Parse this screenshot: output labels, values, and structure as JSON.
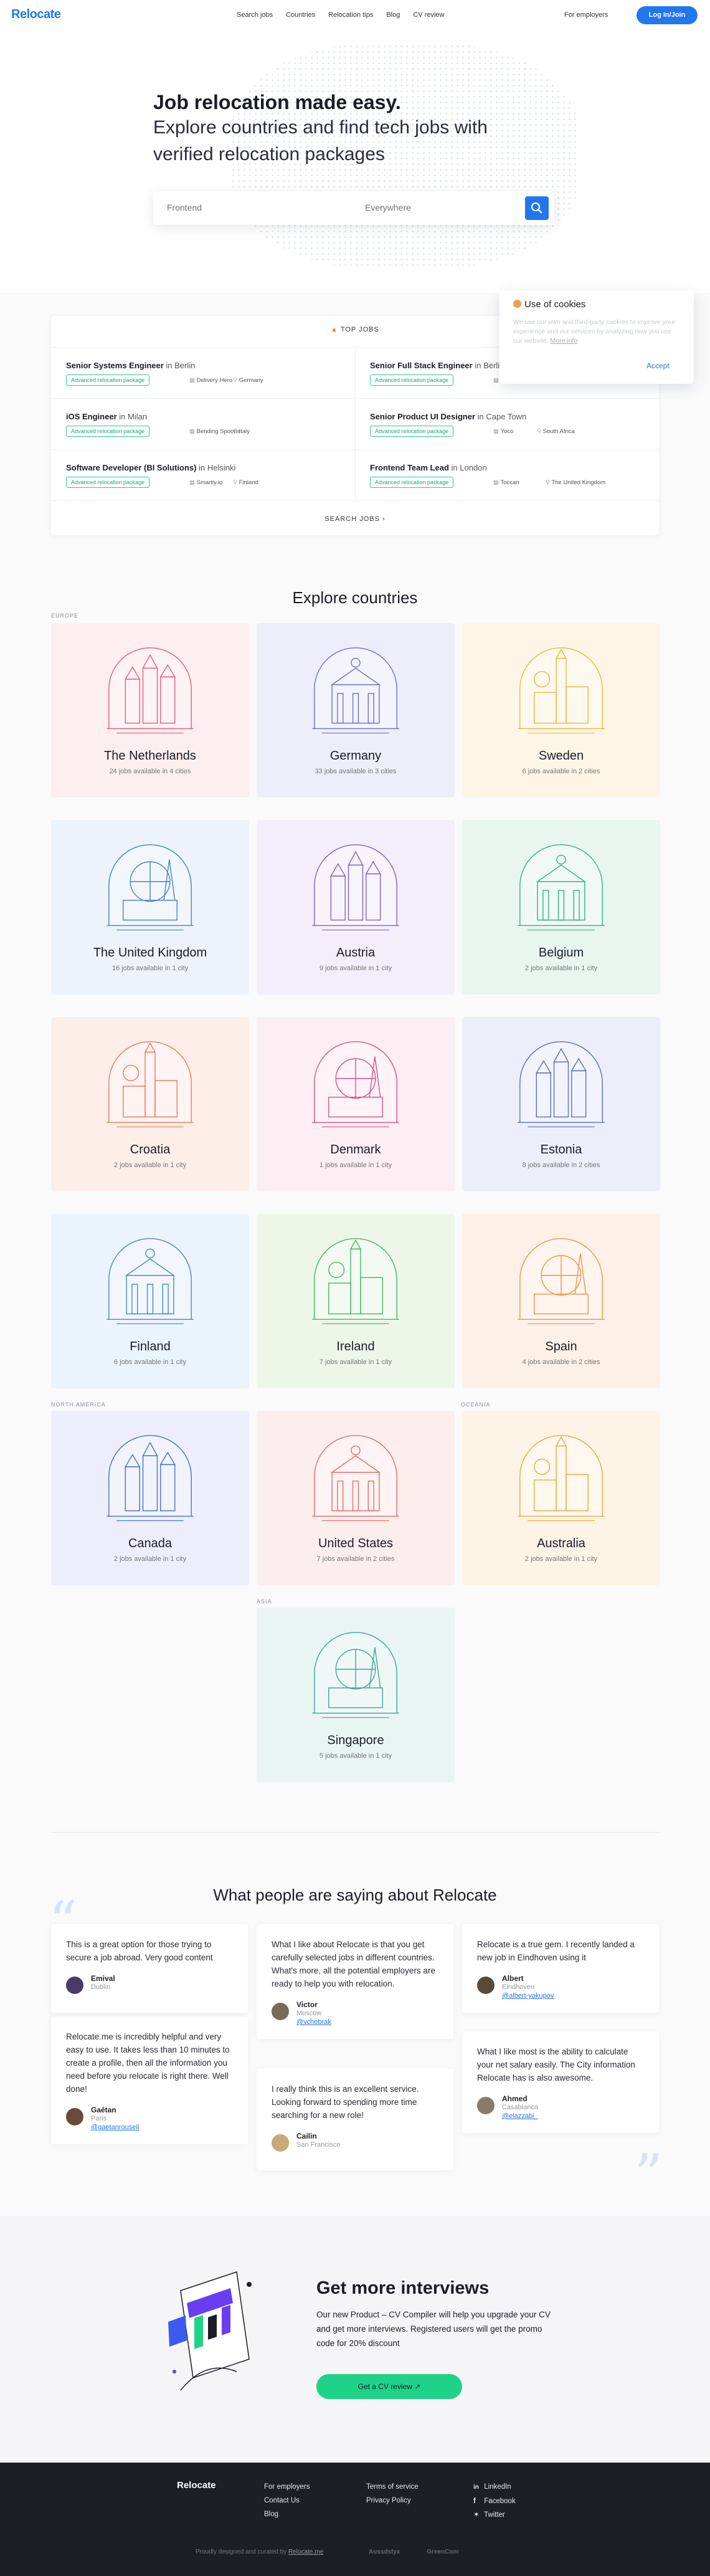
{
  "header": {
    "logo": "Relocate",
    "nav": [
      "Search jobs",
      "Countries",
      "Relocation tips",
      "Blog",
      "CV review"
    ],
    "employers": "For employers",
    "login": "Log In/Join"
  },
  "hero": {
    "title": "Job relocation made easy.",
    "subtitle_line1": "Explore countries and find tech jobs with",
    "subtitle_line2": "verified relocation packages",
    "search_placeholder": "Frontend",
    "location_placeholder": "Everywhere"
  },
  "cookie": {
    "title": "Use of cookies",
    "text": "We use our own and third-party cookies to improve your experience and our services by analyzing how you use our website.",
    "more": "More info",
    "accept": "Accept",
    "icon": "cookie-icon"
  },
  "jobs": {
    "heading": "TOP JOBS",
    "in": "in",
    "badge": "Advanced relocation package",
    "search_all": "SEARCH JOBS",
    "items": [
      {
        "title": "Senior Systems Engineer",
        "city": "Berlin",
        "company": "Delivery Hero",
        "country": "Germany"
      },
      {
        "title": "Senior Full Stack Engineer",
        "city": "Berlin",
        "company": "Babbel",
        "country": "Germany"
      },
      {
        "title": "iOS Engineer",
        "city": "Milan",
        "company": "Bending Spoons",
        "country": "Italy"
      },
      {
        "title": "Senior Product UI Designer",
        "city": "Cape Town",
        "company": "Yoco",
        "country": "South Africa"
      },
      {
        "title": "Software Developer (BI Solutions)",
        "city": "Helsinki",
        "company": "Smartly.io",
        "country": "Finland"
      },
      {
        "title": "Frontend Team Lead",
        "city": "London",
        "company": "Toccan",
        "country": "The United Kingdom"
      }
    ]
  },
  "explore": {
    "title": "Explore countries",
    "regions": {
      "europe": "EUROPE",
      "north_america": "NORTH AMERICA",
      "oceania": "OCEANIA",
      "asia": "ASIA"
    },
    "countries": [
      {
        "name": "The Netherlands",
        "jobs": "24 jobs available in 4 cities",
        "bg": "#fdeef0",
        "line": "#ea5c7a"
      },
      {
        "name": "Germany",
        "jobs": "33 jobs available in 3 cities",
        "bg": "#eeeefb",
        "line": "#6c6fd8"
      },
      {
        "name": "Sweden",
        "jobs": "6 jobs available in 2 cities",
        "bg": "#fdf6e6",
        "line": "#efb63f"
      },
      {
        "name": "The United Kingdom",
        "jobs": "16 jobs available in 1 city",
        "bg": "#ecf3fb",
        "line": "#4a7fcc"
      },
      {
        "name": "Austria",
        "jobs": "9 jobs available in 1 city",
        "bg": "#f3effa",
        "line": "#8262c4"
      },
      {
        "name": "Belgium",
        "jobs": "2 jobs available in 1 city",
        "bg": "#e9f6f0",
        "line": "#2fb58a"
      },
      {
        "name": "Croatia",
        "jobs": "2 jobs available in 1 city",
        "bg": "#fdeeea",
        "line": "#ea7a62"
      },
      {
        "name": "Denmark",
        "jobs": "1 jobs available in 1 city",
        "bg": "#fdeef3",
        "line": "#d9508a"
      },
      {
        "name": "Estonia",
        "jobs": "8 jobs available in 2 cities",
        "bg": "#eceffa",
        "line": "#5c6cc8"
      },
      {
        "name": "Finland",
        "jobs": "6 jobs available in 1 city",
        "bg": "#ebf3fc",
        "line": "#4a86d6"
      },
      {
        "name": "Ireland",
        "jobs": "7 jobs available in 1 city",
        "bg": "#ecf7ea",
        "line": "#4cb56a"
      },
      {
        "name": "Spain",
        "jobs": "4 jobs available in 2 cities",
        "bg": "#fdf0e6",
        "line": "#f0944a"
      },
      {
        "name": "Canada",
        "jobs": "2 jobs available in 1 city",
        "bg": "#eceffb",
        "line": "#4a6ed2"
      },
      {
        "name": "United States",
        "jobs": "7 jobs available in 2 cities",
        "bg": "#fdeeee",
        "line": "#e86a6a"
      },
      {
        "name": "Australia",
        "jobs": "2 jobs available in 1 city",
        "bg": "#fdf4e6",
        "line": "#eea83f"
      },
      {
        "name": "Singapore",
        "jobs": "5 jobs available in 1 city",
        "bg": "#e9f5f3",
        "line": "#3aa89a"
      }
    ]
  },
  "reviews": {
    "title": "What people are saying about Relocate",
    "items": [
      {
        "text": "This is a great option for those trying to secure a job abroad. Very good content",
        "name": "Emival",
        "city": "Dublin",
        "handle": "",
        "avatar": "#4a3a6a"
      },
      {
        "text": "Relocate.me is incredibly helpful and very easy to use. It takes less than 10 minutes to create a profile, then all the information you need before you relocate is right there. Well done!",
        "name": "Gaétan",
        "city": "Paris",
        "handle": "@gaetanrouseil",
        "avatar": "#6a4a3a"
      },
      {
        "text": "What I like about Relocate is that you get carefully selected jobs in different countries. What's more, all the potential employers are ready to help you with relocation.",
        "name": "Victor",
        "city": "Moscow",
        "handle": "@vchebrak",
        "avatar": "#7a6a5a"
      },
      {
        "text": "I really think this is an excellent service. Looking forward to spending more time searching for a new role!",
        "name": "Cailin",
        "city": "San Francisco",
        "handle": "",
        "avatar": "#c8a87a"
      },
      {
        "text": "Relocate is a true gem. I recently landed a new job in Eindhoven using it",
        "name": "Albert",
        "city": "Eindhoven",
        "handle": "@albert-yakupov",
        "avatar": "#5a4a3a"
      },
      {
        "text": "What I like most is the ability to calculate your net salary easily. The City information Relocate has is also awesome.",
        "name": "Ahmed",
        "city": "Casablanca",
        "handle": "@elazzabi_",
        "avatar": "#8a7a6a"
      }
    ]
  },
  "promo": {
    "title": "Get more interviews",
    "text": "Our new Product – CV Compiler will help you upgrade your CV and get more interviews. Registered users will get the promo code for 20% discount",
    "button": "Get a CV review"
  },
  "footer": {
    "logo": "Relocate",
    "col1": [
      "For employers",
      "Contact Us",
      "Blog"
    ],
    "col2": [
      "Terms of service",
      "Privacy Policy"
    ],
    "social": [
      "LinkedIn",
      "Facebook",
      "Twitter"
    ],
    "credit": "Proudly designed and curated by",
    "credit_link": "Relocate.me",
    "partners": [
      "Aussdstyx",
      "GreenCom"
    ]
  }
}
